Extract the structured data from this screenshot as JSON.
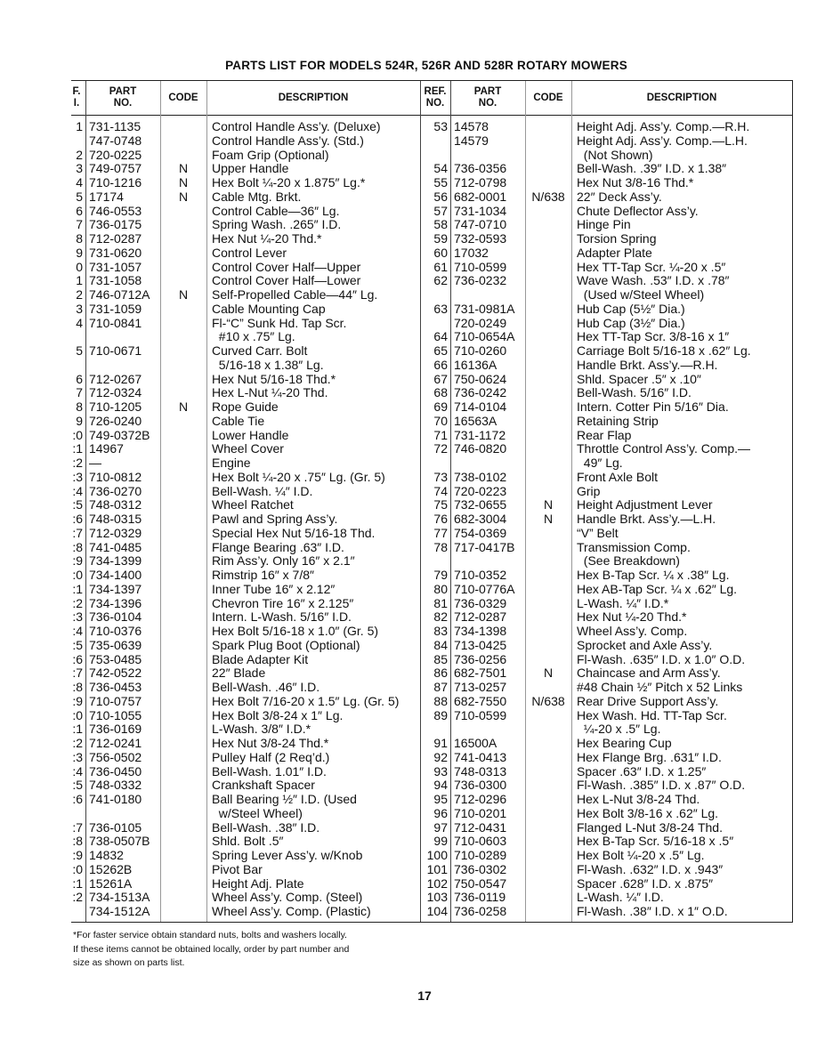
{
  "title": "PARTS LIST FOR MODELS 524R, 526R AND 528R ROTARY MOWERS",
  "headers": {
    "left": {
      "ref": "F.\nI.",
      "part": "PART\nNO.",
      "code": "CODE",
      "desc": "DESCRIPTION"
    },
    "right": {
      "ref": "REF.\nNO.",
      "part": "PART\nNO.",
      "code": "CODE",
      "desc": "DESCRIPTION"
    }
  },
  "left_rows": [
    [
      "1",
      "731-1135",
      "",
      "Control Handle Ass’y. (Deluxe)"
    ],
    [
      "",
      "747-0748",
      "",
      "Control Handle Ass’y. (Std.)"
    ],
    [
      "2",
      "720-0225",
      "",
      "Foam Grip (Optional)"
    ],
    [
      "3",
      "749-0757",
      "N",
      "Upper Handle"
    ],
    [
      "4",
      "710-1216",
      "N",
      "Hex Bolt ¼-20 x 1.875″ Lg.*"
    ],
    [
      "5",
      "17174",
      "N",
      "Cable Mtg. Brkt."
    ],
    [
      "6",
      "746-0553",
      "",
      "Control Cable—36″ Lg."
    ],
    [
      "7",
      "736-0175",
      "",
      "Spring Wash. .265″ I.D."
    ],
    [
      "8",
      "712-0287",
      "",
      "Hex Nut ¼-20 Thd.*"
    ],
    [
      "9",
      "731-0620",
      "",
      "Control Lever"
    ],
    [
      "0",
      "731-1057",
      "",
      "Control Cover Half—Upper"
    ],
    [
      "1",
      "731-1058",
      "",
      "Control Cover Half—Lower"
    ],
    [
      "2",
      "746-0712A",
      "N",
      "Self-Propelled Cable—44″ Lg."
    ],
    [
      "3",
      "731-1059",
      "",
      "Cable Mounting Cap"
    ],
    [
      "4",
      "710-0841",
      "",
      "Fl-“C” Sunk Hd. Tap Scr."
    ],
    [
      "",
      "",
      "",
      "  #10 x .75″ Lg."
    ],
    [
      "5",
      "710-0671",
      "",
      "Curved Carr. Bolt"
    ],
    [
      "",
      "",
      "",
      "  5/16-18 x 1.38″ Lg."
    ],
    [
      "6",
      "712-0267",
      "",
      "Hex Nut 5/16-18 Thd.*"
    ],
    [
      "7",
      "712-0324",
      "",
      "Hex L-Nut ¼-20 Thd."
    ],
    [
      "8",
      "710-1205",
      "N",
      "Rope Guide"
    ],
    [
      "9",
      "726-0240",
      "",
      "Cable Tie"
    ],
    [
      ":0",
      "749-0372B",
      "",
      "Lower Handle"
    ],
    [
      ":1",
      "14967",
      "",
      "Wheel Cover"
    ],
    [
      ":2",
      "—",
      "",
      "Engine"
    ],
    [
      ":3",
      "710-0812",
      "",
      "Hex Bolt ¼-20 x .75″ Lg. (Gr. 5)"
    ],
    [
      ":4",
      "736-0270",
      "",
      "Bell-Wash. ¼″ I.D."
    ],
    [
      ":5",
      "748-0312",
      "",
      "Wheel Ratchet"
    ],
    [
      ":6",
      "748-0315",
      "",
      "Pawl and Spring Ass’y."
    ],
    [
      ":7",
      "712-0329",
      "",
      "Special Hex Nut 5/16-18 Thd."
    ],
    [
      ":8",
      "741-0485",
      "",
      "Flange Bearing .63″ I.D."
    ],
    [
      ":9",
      "734-1399",
      "",
      "Rim Ass’y. Only 16″ x 2.1″"
    ],
    [
      ":0",
      "734-1400",
      "",
      "Rimstrip 16″ x 7/8″"
    ],
    [
      ":1",
      "734-1397",
      "",
      "Inner Tube 16″ x 2.12″"
    ],
    [
      ":2",
      "734-1396",
      "",
      "Chevron Tire 16″ x 2.125″"
    ],
    [
      ":3",
      "736-0104",
      "",
      "Intern. L-Wash. 5/16″ I.D."
    ],
    [
      ":4",
      "710-0376",
      "",
      "Hex Bolt 5/16-18 x 1.0″ (Gr. 5)"
    ],
    [
      ":5",
      "735-0639",
      "",
      "Spark Plug Boot (Optional)"
    ],
    [
      ":6",
      "753-0485",
      "",
      "Blade Adapter Kit"
    ],
    [
      ":7",
      "742-0522",
      "",
      "22″ Blade"
    ],
    [
      ":8",
      "736-0453",
      "",
      "Bell-Wash. .46″ I.D."
    ],
    [
      ":9",
      "710-0757",
      "",
      "Hex Bolt 7/16-20 x 1.5″ Lg. (Gr. 5)"
    ],
    [
      ":0",
      "710-1055",
      "",
      "Hex Bolt 3/8-24 x 1″ Lg."
    ],
    [
      ":1",
      "736-0169",
      "",
      "L-Wash. 3/8″ I.D.*"
    ],
    [
      ":2",
      "712-0241",
      "",
      "Hex Nut 3/8-24 Thd.*"
    ],
    [
      ":3",
      "756-0502",
      "",
      "Pulley Half (2 Req’d.)"
    ],
    [
      ":4",
      "736-0450",
      "",
      "Bell-Wash. 1.01″ I.D."
    ],
    [
      ":5",
      "748-0332",
      "",
      "Crankshaft Spacer"
    ],
    [
      ":6",
      "741-0180",
      "",
      "Ball Bearing ½″ I.D. (Used"
    ],
    [
      "",
      "",
      "",
      "  w/Steel Wheel)"
    ],
    [
      ":7",
      "736-0105",
      "",
      "Bell-Wash. .38″ I.D."
    ],
    [
      ":8",
      "738-0507B",
      "",
      "Shld. Bolt .5″"
    ],
    [
      ":9",
      "14832",
      "",
      "Spring Lever Ass’y. w/Knob"
    ],
    [
      ":0",
      "15262B",
      "",
      "Pivot Bar"
    ],
    [
      ":1",
      "15261A",
      "",
      "Height Adj. Plate"
    ],
    [
      ":2",
      "734-1513A",
      "",
      "Wheel Ass’y. Comp. (Steel)"
    ],
    [
      "",
      "734-1512A",
      "",
      "Wheel Ass’y. Comp. (Plastic)"
    ]
  ],
  "right_rows": [
    [
      "53",
      "14578",
      "",
      "Height Adj. Ass’y. Comp.—R.H."
    ],
    [
      "",
      "14579",
      "",
      "Height Adj. Ass’y. Comp.—L.H."
    ],
    [
      "",
      "",
      "",
      "  (Not Shown)"
    ],
    [
      "54",
      "736-0356",
      "",
      "Bell-Wash. .39″ I.D. x 1.38″"
    ],
    [
      "55",
      "712-0798",
      "",
      "Hex Nut 3/8-16 Thd.*"
    ],
    [
      "56",
      "682-0001",
      "N/638",
      "22″ Deck Ass’y."
    ],
    [
      "57",
      "731-1034",
      "",
      "Chute Deflector Ass’y."
    ],
    [
      "58",
      "747-0710",
      "",
      "Hinge Pin"
    ],
    [
      "59",
      "732-0593",
      "",
      "Torsion Spring"
    ],
    [
      "60",
      "17032",
      "",
      "Adapter Plate"
    ],
    [
      "61",
      "710-0599",
      "",
      "Hex TT-Tap Scr. ¼-20 x .5″"
    ],
    [
      "62",
      "736-0232",
      "",
      "Wave Wash. .53″ I.D. x .78″"
    ],
    [
      "",
      "",
      "",
      "  (Used w/Steel Wheel)"
    ],
    [
      "63",
      "731-0981A",
      "",
      "Hub Cap (5½″ Dia.)"
    ],
    [
      "",
      "720-0249",
      "",
      "Hub Cap (3½″ Dia.)"
    ],
    [
      "64",
      "710-0654A",
      "",
      "Hex TT-Tap Scr. 3/8-16 x 1″"
    ],
    [
      "65",
      "710-0260",
      "",
      "Carriage Bolt 5/16-18 x .62″ Lg."
    ],
    [
      "66",
      "16136A",
      "",
      "Handle Brkt. Ass’y.—R.H."
    ],
    [
      "67",
      "750-0624",
      "",
      "Shld. Spacer .5″ x .10″"
    ],
    [
      "68",
      "736-0242",
      "",
      "Bell-Wash. 5/16″ I.D."
    ],
    [
      "69",
      "714-0104",
      "",
      "Intern. Cotter Pin 5/16″ Dia."
    ],
    [
      "70",
      "16563A",
      "",
      "Retaining Strip"
    ],
    [
      "71",
      "731-1172",
      "",
      "Rear Flap"
    ],
    [
      "72",
      "746-0820",
      "",
      "Throttle Control Ass’y. Comp.—"
    ],
    [
      "",
      "",
      "",
      "  49″ Lg."
    ],
    [
      "73",
      "738-0102",
      "",
      "Front Axle Bolt"
    ],
    [
      "74",
      "720-0223",
      "",
      "Grip"
    ],
    [
      "75",
      "732-0655",
      "N",
      "Height Adjustment Lever"
    ],
    [
      "76",
      "682-3004",
      "N",
      "Handle Brkt. Ass’y.—L.H."
    ],
    [
      "77",
      "754-0369",
      "",
      "“V” Belt"
    ],
    [
      "78",
      "717-0417B",
      "",
      "Transmission Comp."
    ],
    [
      "",
      "",
      "",
      "  (See Breakdown)"
    ],
    [
      "79",
      "710-0352",
      "",
      "Hex B-Tap Scr. ¼ x .38″ Lg."
    ],
    [
      "80",
      "710-0776A",
      "",
      "Hex AB-Tap Scr. ¼ x .62″ Lg."
    ],
    [
      "81",
      "736-0329",
      "",
      "L-Wash. ¼″ I.D.*"
    ],
    [
      "82",
      "712-0287",
      "",
      "Hex Nut ¼-20 Thd.*"
    ],
    [
      "83",
      "734-1398",
      "",
      "Wheel Ass’y. Comp."
    ],
    [
      "84",
      "713-0425",
      "",
      "Sprocket and Axle Ass’y."
    ],
    [
      "85",
      "736-0256",
      "",
      "Fl-Wash. .635″ I.D. x 1.0″ O.D."
    ],
    [
      "86",
      "682-7501",
      "N",
      "Chaincase and Arm Ass’y."
    ],
    [
      "87",
      "713-0257",
      "",
      "#48 Chain ½″ Pitch x 52 Links"
    ],
    [
      "88",
      "682-7550",
      "N/638",
      "Rear Drive Support Ass’y."
    ],
    [
      "89",
      "710-0599",
      "",
      "Hex Wash. Hd. TT-Tap Scr."
    ],
    [
      "",
      "",
      "",
      "  ¼-20 x .5″ Lg."
    ],
    [
      "91",
      "16500A",
      "",
      "Hex Bearing Cup"
    ],
    [
      "92",
      "741-0413",
      "",
      "Hex Flange Brg. .631″ I.D."
    ],
    [
      "93",
      "748-0313",
      "",
      "Spacer .63″ I.D. x 1.25″"
    ],
    [
      "94",
      "736-0300",
      "",
      "Fl-Wash. .385″ I.D. x .87″ O.D."
    ],
    [
      "95",
      "712-0296",
      "",
      "Hex L-Nut 3/8-24 Thd."
    ],
    [
      "96",
      "710-0201",
      "",
      "Hex Bolt 3/8-16 x .62″ Lg."
    ],
    [
      "97",
      "712-0431",
      "",
      "Flanged L-Nut 3/8-24 Thd."
    ],
    [
      "99",
      "710-0603",
      "",
      "Hex B-Tap Scr. 5/16-18 x .5″"
    ],
    [
      "100",
      "710-0289",
      "",
      "Hex Bolt ¼-20 x .5″ Lg."
    ],
    [
      "101",
      "736-0302",
      "",
      "Fl-Wash. .632″ I.D. x .943″"
    ],
    [
      "102",
      "750-0547",
      "",
      "Spacer .628″ I.D. x .875″"
    ],
    [
      "103",
      "736-0119",
      "",
      "L-Wash. ¼″ I.D."
    ],
    [
      "104",
      "736-0258",
      "",
      "Fl-Wash. .38″ I.D. x 1″ O.D."
    ]
  ],
  "footnote": [
    "*For faster service obtain standard nuts, bolts and washers locally.",
    "If these items cannot be obtained locally, order by part number and",
    "size as shown on parts list."
  ],
  "page_number": "17"
}
